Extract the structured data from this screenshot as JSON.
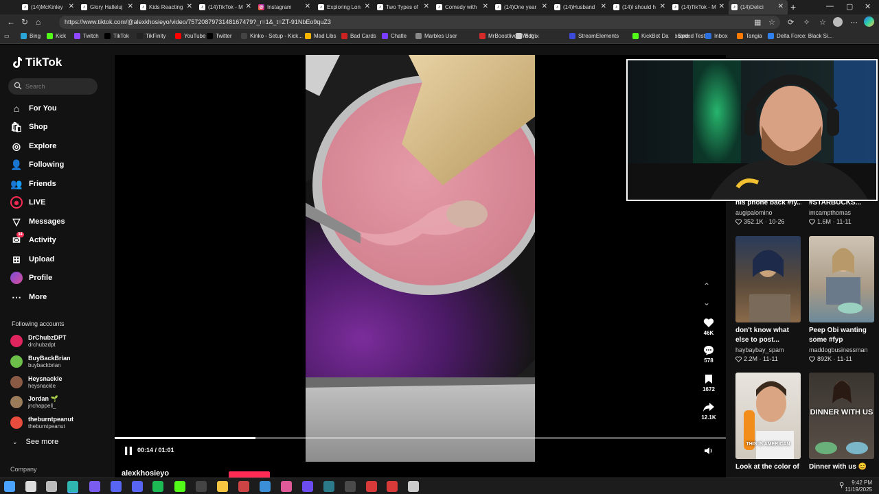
{
  "browser": {
    "tabs": [
      {
        "title": "(14)McKinley",
        "icon": "tiktok-icon"
      },
      {
        "title": "Glory Halleluj",
        "icon": "tiktok-icon"
      },
      {
        "title": "Kids Reacting",
        "icon": "tiktok-icon"
      },
      {
        "title": "(14)TikTok - M",
        "icon": "tiktok-icon"
      },
      {
        "title": "Instagram",
        "icon": "instagram-icon"
      },
      {
        "title": "Exploring Lon",
        "icon": "tiktok-icon"
      },
      {
        "title": "Two Types of",
        "icon": "tiktok-icon"
      },
      {
        "title": "Comedy with",
        "icon": "tiktok-icon"
      },
      {
        "title": "(14)One year",
        "icon": "tiktok-icon"
      },
      {
        "title": "(14)Husband",
        "icon": "tiktok-icon"
      },
      {
        "title": "(14)I should h",
        "icon": "tiktok-icon"
      },
      {
        "title": "(14)TikTok - M",
        "icon": "tiktok-icon"
      },
      {
        "title": "(14)Delici",
        "icon": "tiktok-icon"
      }
    ],
    "url": "https://www.tiktok.com/@alexkhosieyo/video/7572087973148167479?_r=1&_t=ZT-91NbEo9quZ3",
    "bookmarks": [
      {
        "label": "Bing",
        "color": "#2aa5d8"
      },
      {
        "label": "Kick",
        "color": "#53fc18"
      },
      {
        "label": "Twitch",
        "color": "#9146ff"
      },
      {
        "label": "TikTok",
        "color": "#000000"
      },
      {
        "label": "TikFinity",
        "color": "#222222"
      },
      {
        "label": "YouTube",
        "color": "#ff0000"
      },
      {
        "label": "Twitter",
        "color": "#000000"
      },
      {
        "label": "Kinko - Setup - Kick...",
        "color": "#444444"
      },
      {
        "label": "Mad Libs",
        "color": "#f5b400"
      },
      {
        "label": "Bad Cards",
        "color": "#cc2222"
      },
      {
        "label": "Chatle",
        "color": "#7a3cff"
      },
      {
        "label": "Marbles User",
        "color": "#888888"
      },
      {
        "label": "MrBoostlive - Widg...",
        "color": "#d52a2a"
      },
      {
        "label": "Botrix",
        "color": "#cccccc"
      },
      {
        "label": "StreamElements",
        "color": "#3b4bd8"
      },
      {
        "label": "KickBot Dashboard",
        "color": "#53fc18"
      },
      {
        "label": "Speed Test",
        "color": "#2a2a2a"
      },
      {
        "label": "Inbox",
        "color": "#2a6fdb"
      },
      {
        "label": "Tangia",
        "color": "#ff7a00"
      },
      {
        "label": "Delta Force: Black Si...",
        "color": "#2f80ed"
      }
    ]
  },
  "tiktok": {
    "logo": "TikTok",
    "search_placeholder": "Search",
    "nav": [
      {
        "label": "For You",
        "icon": "home-icon"
      },
      {
        "label": "Shop",
        "icon": "shop-icon"
      },
      {
        "label": "Explore",
        "icon": "compass-icon"
      },
      {
        "label": "Following",
        "icon": "following-icon"
      },
      {
        "label": "Friends",
        "icon": "friends-icon"
      },
      {
        "label": "LIVE",
        "icon": "live-icon"
      },
      {
        "label": "Messages",
        "icon": "messages-icon"
      },
      {
        "label": "Activity",
        "icon": "activity-icon",
        "badge": "34"
      },
      {
        "label": "Upload",
        "icon": "upload-icon"
      },
      {
        "label": "Profile",
        "icon": "profile-icon"
      },
      {
        "label": "More",
        "icon": "more-icon"
      }
    ],
    "following_title": "Following accounts",
    "accounts": [
      {
        "name": "DrChubzDPT",
        "handle": "drchubzdpt",
        "color": "#e0245e"
      },
      {
        "name": "BuyBackBrian",
        "handle": "buybackbrian",
        "color": "#6cc04a"
      },
      {
        "name": "Heysnackle",
        "handle": "heysnackle",
        "color": "#8a5a44"
      },
      {
        "name": "Jordan 🌱",
        "handle": "jnchappell_",
        "color": "#9a7b5a"
      },
      {
        "name": "theburntpeanut",
        "handle": "theburntpeanut",
        "color": "#e74c3c"
      }
    ],
    "see_more": "See more",
    "company": "Company",
    "video": {
      "time": "00:14 / 01:01",
      "progress": 0.23,
      "author": "alexkhosieyo",
      "likes": "46K",
      "comments": "578",
      "saves": "1672",
      "shares": "12.1K"
    },
    "recommended": [
      {
        "title": "his phone back #fy...",
        "user": "augipalomino",
        "likes": "352.1K",
        "date": "10-26"
      },
      {
        "title": "#STARBUCKS...",
        "user": "imcampthomas",
        "likes": "1.6M",
        "date": "11-11"
      },
      {
        "title": "don't know what else to post...",
        "user": "haybaybay_spam",
        "likes": "2.2M",
        "date": "11-11"
      },
      {
        "title": "Peep Obi wanting some #fyp #baking...",
        "user": "maddogbusinessman",
        "likes": "892K",
        "date": "11-11"
      },
      {
        "title": "Look at the color of",
        "user": "",
        "likes": "",
        "date": "",
        "thumb_caption": "THIS IS AMERICAN"
      },
      {
        "title": "Dinner with us 😊",
        "user": "",
        "likes": "",
        "date": "",
        "thumb_caption": "DINNER WITH US"
      }
    ]
  },
  "taskbar": {
    "time": "9:42 PM",
    "date": "11/19/2025"
  }
}
